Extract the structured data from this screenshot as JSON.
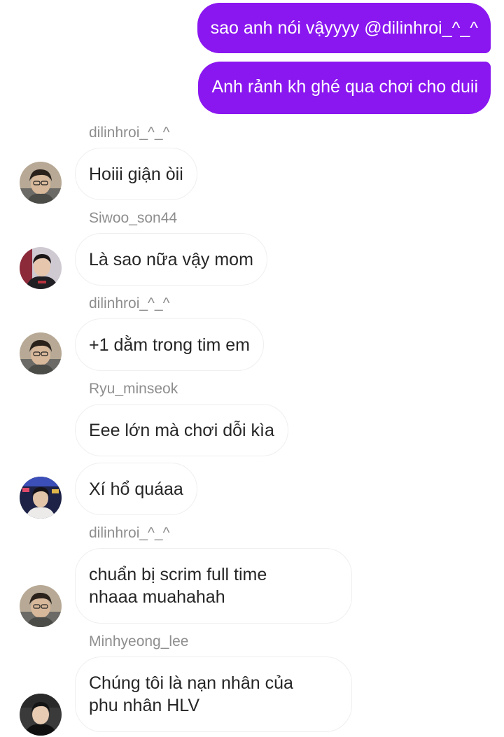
{
  "outgoing": [
    {
      "text": "sao anh nói vậyyyy @dilinhroi_^_^"
    },
    {
      "text": "Anh rảnh kh ghé qua chơi cho duii"
    }
  ],
  "messages": [
    {
      "sender": "dilinhroi_^_^",
      "text": "Hoiii giận òii"
    },
    {
      "sender": "Siwoo_son44",
      "text": "Là sao nữa vậy mom"
    },
    {
      "sender": "dilinhroi_^_^",
      "text": "+1 dằm trong tim em"
    },
    {
      "sender": "Ryu_minseok",
      "text": "Eee lớn mà chơi dỗi kìa"
    },
    {
      "sender": "",
      "text": "Xí hổ quáaa"
    },
    {
      "sender": "dilinhroi_^_^",
      "text_line1": "chuẩn bị scrim full time",
      "text_line2": "nhaaa muahahah"
    },
    {
      "sender": "Minhyeong_lee",
      "text_line1": "Chúng tôi là nạn nhân của",
      "text_line2": "phu nhân HLV"
    }
  ],
  "avatars": {
    "dilinhroi": "avatar-dilinhroi",
    "siwoo": "avatar-siwoo",
    "ryu": "avatar-ryu",
    "minhyeong": "avatar-minhyeong"
  },
  "colors": {
    "outgoing_bubble": "#8a16f0",
    "incoming_border": "#efefef",
    "sender_name": "#8e8e8e",
    "text": "#262626"
  }
}
